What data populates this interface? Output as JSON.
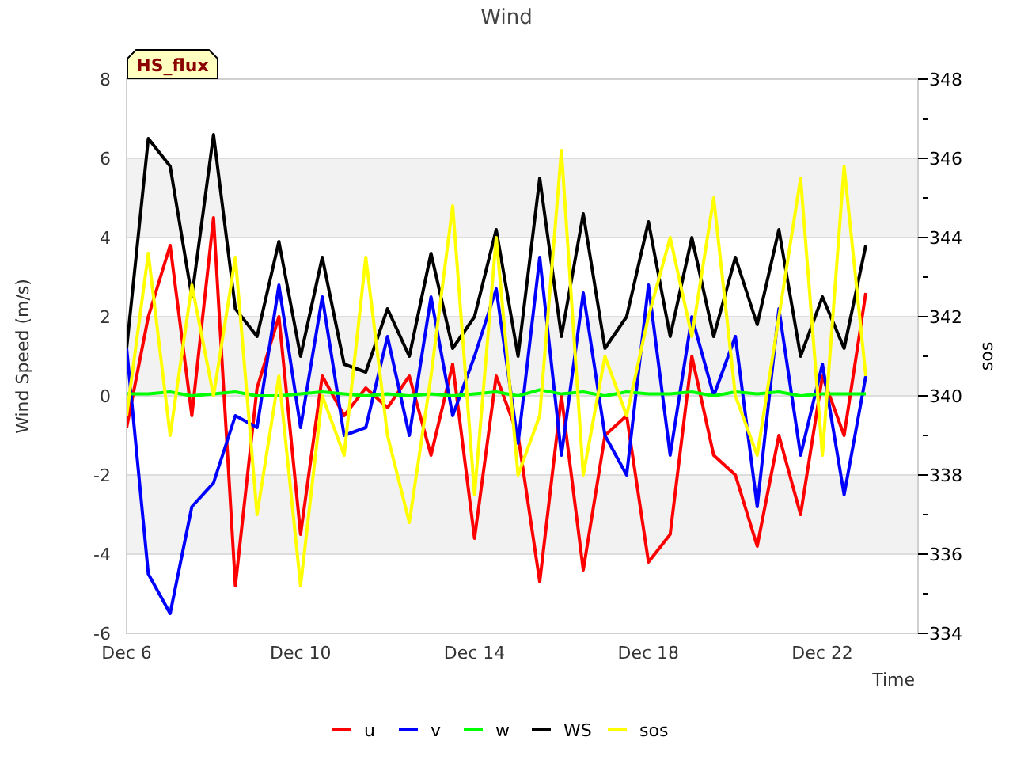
{
  "chart": {
    "badge": "HS_flux",
    "chart_data": {
      "type": "line",
      "title": "Wind",
      "xlabel": "Time",
      "ylabel": "Wind Speed (m/s)",
      "y2label": "sos",
      "categories": [
        "Dec 6",
        null,
        null,
        null,
        null,
        null,
        null,
        null,
        "Dec 10",
        null,
        null,
        null,
        null,
        null,
        null,
        null,
        "Dec 14",
        null,
        null,
        null,
        null,
        null,
        null,
        null,
        "Dec 18",
        null,
        null,
        null,
        null,
        null,
        null,
        null,
        "Dec 22",
        null,
        null
      ],
      "ylim": [
        -6,
        8
      ],
      "y2lim": [
        334,
        348
      ],
      "grid": true,
      "legend": true,
      "bands": [
        {
          "axis": "y",
          "from": 4,
          "to": 6
        },
        {
          "axis": "y",
          "from": 0,
          "to": 2
        },
        {
          "axis": "y",
          "from": -4,
          "to": -2
        }
      ],
      "yticks": [
        -6,
        -4,
        -2,
        0,
        2,
        4,
        6,
        8
      ],
      "y2ticks": [
        334,
        336,
        338,
        340,
        342,
        344,
        346,
        348
      ],
      "series": [
        {
          "name": "u",
          "color": "#ff0000",
          "values": [
            -0.8,
            2.0,
            3.8,
            -0.5,
            4.5,
            -4.8,
            0.2,
            2.0,
            -3.5,
            0.5,
            -0.5,
            0.2,
            -0.3,
            0.5,
            -1.5,
            0.8,
            -3.6,
            0.5,
            -1.0,
            -4.7,
            0.0,
            -4.4,
            -1.0,
            -0.5,
            -4.2,
            -3.5,
            1.0,
            -1.5,
            -2.0,
            -3.8,
            -1.0,
            -3.0,
            0.5,
            -1.0,
            2.6
          ]
        },
        {
          "name": "v",
          "color": "#0000ff",
          "values": [
            1.2,
            -4.5,
            -5.5,
            -2.8,
            -2.2,
            -0.5,
            -0.8,
            2.8,
            -0.8,
            2.5,
            -1.0,
            -0.8,
            1.5,
            -1.0,
            2.5,
            -0.5,
            1.0,
            2.7,
            -1.2,
            3.5,
            -1.5,
            2.6,
            -1.0,
            -2.0,
            2.8,
            -1.5,
            2.0,
            0.0,
            1.5,
            -2.8,
            2.2,
            -1.5,
            0.8,
            -2.5,
            0.5
          ]
        },
        {
          "name": "w",
          "color": "#00ff00",
          "values": [
            0.05,
            0.05,
            0.1,
            0.0,
            0.05,
            0.1,
            0.0,
            0.0,
            0.05,
            0.1,
            0.05,
            0.0,
            0.05,
            0.0,
            0.05,
            0.0,
            0.05,
            0.1,
            0.0,
            0.15,
            0.05,
            0.1,
            0.0,
            0.1,
            0.05,
            0.05,
            0.1,
            0.0,
            0.1,
            0.05,
            0.1,
            0.0,
            0.05,
            0.05,
            0.05
          ]
        },
        {
          "name": "WS",
          "color": "#000000",
          "values": [
            1.2,
            6.5,
            5.8,
            2.5,
            6.6,
            2.2,
            1.5,
            3.9,
            1.0,
            3.5,
            0.8,
            0.6,
            2.2,
            1.0,
            3.6,
            1.2,
            2.0,
            4.2,
            1.0,
            5.5,
            1.5,
            4.6,
            1.2,
            2.0,
            4.4,
            1.5,
            4.0,
            1.5,
            3.5,
            1.8,
            4.2,
            1.0,
            2.5,
            1.2,
            3.8
          ]
        },
        {
          "name": "sos",
          "color": "#ffff00",
          "axis": "y2",
          "values": [
            339.5,
            343.6,
            339.0,
            342.8,
            340.0,
            343.5,
            337.0,
            340.5,
            335.2,
            340.0,
            338.5,
            343.5,
            339.0,
            336.8,
            340.5,
            344.8,
            337.5,
            344.0,
            338.0,
            339.5,
            346.2,
            338.0,
            341.0,
            339.5,
            342.0,
            344.0,
            341.5,
            345.0,
            340.0,
            338.5,
            342.0,
            345.5,
            338.5,
            345.8,
            340.5
          ]
        }
      ]
    }
  }
}
